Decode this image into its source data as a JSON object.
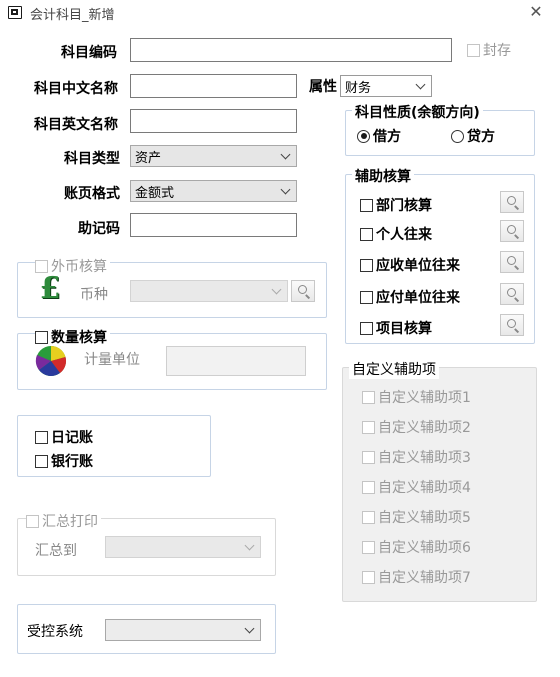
{
  "window": {
    "title": "会计科目_新增"
  },
  "fields": {
    "code_label": "科目编码",
    "code_value": "",
    "frozen_label": "封存",
    "cn_name_label": "科目中文名称",
    "cn_name_value": "",
    "property_label": "属性",
    "property_value": "财务",
    "en_name_label": "科目英文名称",
    "en_name_value": "",
    "type_label": "科目类型",
    "type_value": "资产",
    "ledger_format_label": "账页格式",
    "ledger_format_value": "金额式",
    "mnemonic_label": "助记码",
    "mnemonic_value": ""
  },
  "nature": {
    "legend": "科目性质(余额方向)",
    "debit": "借方",
    "credit": "贷方",
    "selected": "借方"
  },
  "foreign_currency": {
    "legend": "外币核算",
    "currency_label": "币种",
    "currency_value": ""
  },
  "quantity": {
    "legend": "数量核算",
    "unit_label": "计量单位",
    "unit_value": ""
  },
  "journal": {
    "daily": "日记账",
    "bank": "银行账"
  },
  "summary": {
    "legend": "汇总打印",
    "to_label": "汇总到",
    "to_value": ""
  },
  "controlled": {
    "label": "受控系统",
    "value": ""
  },
  "auxiliary": {
    "legend": "辅助核算",
    "items": [
      "部门核算",
      "个人往来",
      "应收单位往来",
      "应付单位往来",
      "项目核算"
    ]
  },
  "custom": {
    "legend": "自定义辅助项",
    "items": [
      "自定义辅助项1",
      "自定义辅助项2",
      "自定义辅助项3",
      "自定义辅助项4",
      "自定义辅助项5",
      "自定义辅助项6",
      "自定义辅助项7"
    ]
  }
}
